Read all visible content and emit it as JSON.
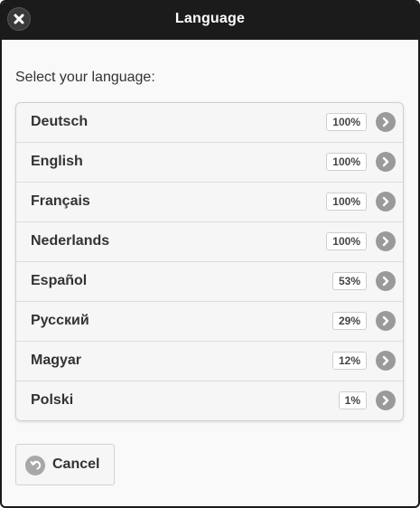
{
  "header": {
    "title": "Language",
    "close_icon": "close-icon"
  },
  "prompt": "Select your language:",
  "languages": [
    {
      "label": "Deutsch",
      "completion": "100%"
    },
    {
      "label": "English",
      "completion": "100%"
    },
    {
      "label": "Français",
      "completion": "100%"
    },
    {
      "label": "Nederlands",
      "completion": "100%"
    },
    {
      "label": "Español",
      "completion": "53%"
    },
    {
      "label": "Русский",
      "completion": "29%"
    },
    {
      "label": "Magyar",
      "completion": "12%"
    },
    {
      "label": "Polski",
      "completion": "1%"
    }
  ],
  "row_icon": "chevron-right-icon",
  "cancel": {
    "label": "Cancel",
    "icon": "back-arrow-icon"
  },
  "colors": {
    "header_bg": "#1b1b1b",
    "header_text": "#ffffff",
    "icon_gray": "#9a9a9a"
  }
}
